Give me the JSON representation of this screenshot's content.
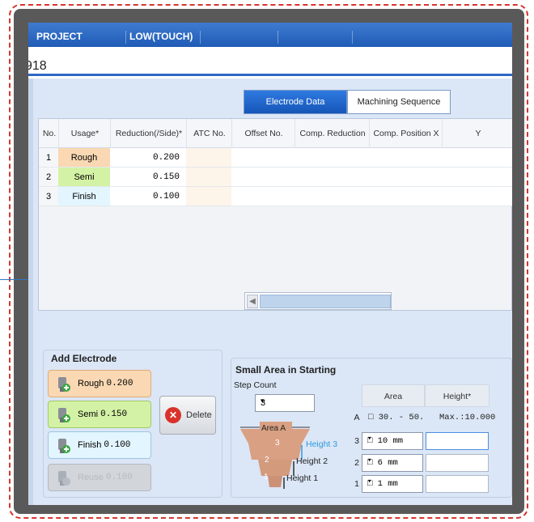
{
  "header": {
    "project_label": "PROJECT",
    "mode_label": "LOW(TOUCH)",
    "id_text": "918"
  },
  "tabs": [
    {
      "label": "Electrode Data",
      "active": true
    },
    {
      "label": "Machining Sequence",
      "active": false
    }
  ],
  "table": {
    "headers": [
      "No.",
      "Usage*",
      "Reduction(/Side)*",
      "ATC No.",
      "Offset No.",
      "Comp. Reduction",
      "Comp. Position X",
      "Y"
    ],
    "rows": [
      {
        "no": "1",
        "usage": "Rough",
        "reduction": "0.200",
        "usage_color": "#f9d8b3"
      },
      {
        "no": "2",
        "usage": "Semi",
        "reduction": "0.150",
        "usage_color": "#d4f2a6"
      },
      {
        "no": "3",
        "usage": "Finish",
        "reduction": "0.100",
        "usage_color": "#e3f5ff"
      }
    ]
  },
  "add_electrode": {
    "title": "Add Electrode",
    "buttons": [
      {
        "label": "Rough",
        "value": "0.200",
        "state": "enabled"
      },
      {
        "label": "Semi",
        "value": "0.150",
        "state": "enabled"
      },
      {
        "label": "Finish",
        "value": "0.100",
        "state": "enabled"
      },
      {
        "label": "Reuse",
        "value": "0.100",
        "state": "disabled"
      }
    ],
    "delete_label": "Delete"
  },
  "small_area": {
    "title": "Small Area in Starting",
    "step_count_label": "Step Count",
    "step_count_value": "3",
    "diagram": {
      "area_label": "Area A",
      "labels": [
        "Height 3",
        "Height 2",
        "Height 1"
      ],
      "step_numbers": [
        "3",
        "2",
        "1"
      ]
    },
    "grid": {
      "col_area": "Area",
      "col_height": "Height*",
      "row_a": {
        "label": "A",
        "area": "□ 30. - 50.",
        "height": "Max.:10.000"
      },
      "rows": [
        {
          "label": "3",
          "area": "□ 10 mm"
        },
        {
          "label": "2",
          "area": "□ 6 mm"
        },
        {
          "label": "1",
          "area": "□ 1 mm"
        }
      ]
    }
  },
  "colors": {
    "title_bar": "#1f5bb6",
    "panel": "#dbe6f6",
    "frame_border": "#d9342f",
    "accent_text": "#2e9be0"
  }
}
